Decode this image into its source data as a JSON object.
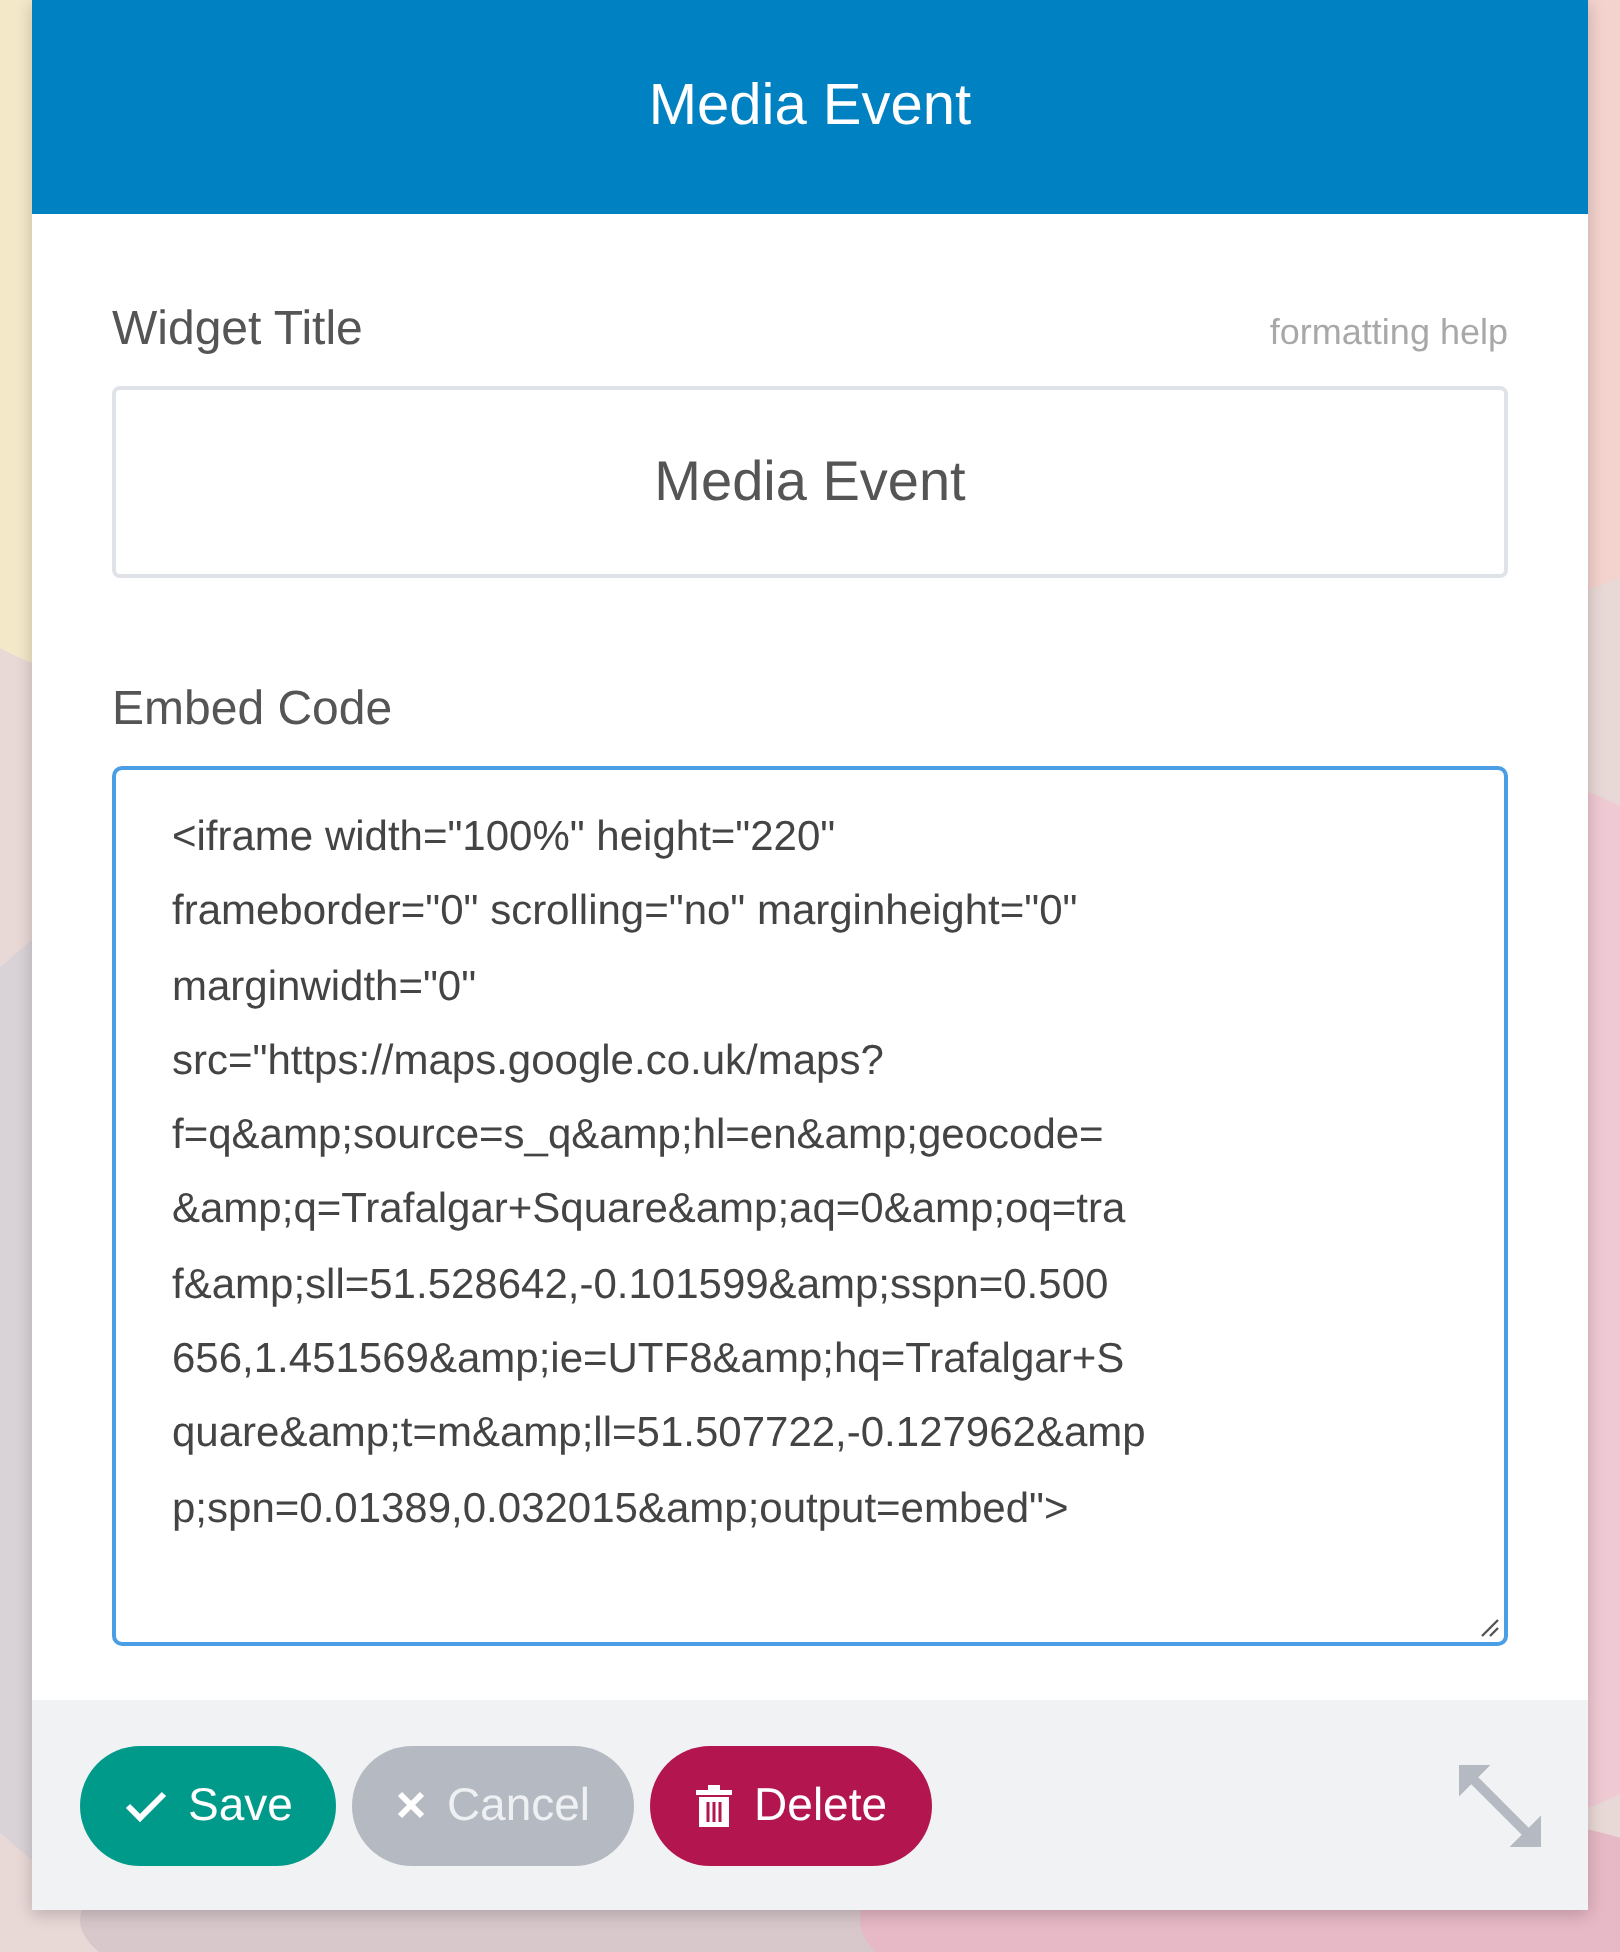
{
  "dialog": {
    "title": "Media Event"
  },
  "title_field": {
    "label": "Widget Title",
    "help_link": "formatting help",
    "value": "Media Event"
  },
  "embed_field": {
    "label": "Embed Code",
    "focused": true,
    "lines": [
      "<iframe width=\"100%\" height=\"220\"",
      "frameborder=\"0\" scrolling=\"no\" marginheight=\"0\"",
      "marginwidth=\"0\"",
      "src=\"https://maps.google.co.uk/maps?",
      "f=q&amp;source=s_q&amp;hl=en&amp;geocode=",
      "&amp;q=Trafalgar+Square&amp;aq=0&amp;oq=tra",
      "f&amp;sll=51.528642,-0.101599&amp;sspn=0.500",
      "656,1.451569&amp;ie=UTF8&amp;hq=Trafalgar+S",
      "quare&amp;t=m&amp;ll=51.507722,-0.127962&amp",
      "p;spn=0.01389,0.032015&amp;output=embed\">"
    ]
  },
  "buttons": [
    {
      "kind": "save",
      "label": "Save",
      "disabled": false
    },
    {
      "kind": "cancel",
      "label": "Cancel",
      "disabled": true
    },
    {
      "kind": "delete",
      "label": "Delete",
      "disabled": false
    }
  ]
}
